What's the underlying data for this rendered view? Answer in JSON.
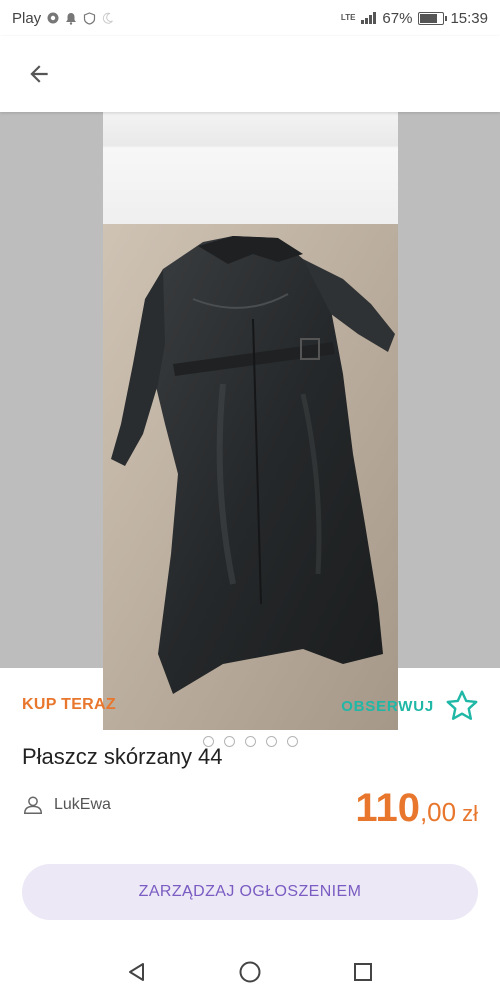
{
  "status_bar": {
    "carrier": "Play",
    "lte": "LTE",
    "battery": "67%",
    "battery_level": 0.67,
    "time": "15:39",
    "icons": [
      "chrome-icon",
      "notification-bell-icon",
      "vpn-icon",
      "moon-icon"
    ]
  },
  "app_bar": {
    "back_icon": "arrow-left-icon"
  },
  "gallery": {
    "image": "black-leather-coat-photo",
    "dot_count": 5,
    "active_dot": 0
  },
  "listing": {
    "buy_now_label": "KUP TERAZ",
    "watch_label": "OBSERWUJ",
    "watch_icon": "star-outline-icon",
    "title": "Płaszcz skórzany 44",
    "seller_icon": "user-icon",
    "seller_name": "LukEwa",
    "price_int": "110",
    "price_dec": ",00",
    "price_currency": "zł",
    "manage_button_label": "ZARZĄDZAJ OGŁOSZENIEM"
  },
  "colors": {
    "accent_orange": "#e8762c",
    "accent_teal": "#1fb7a6",
    "button_bg": "#ece8f6",
    "button_text": "#7a5cc2"
  },
  "nav_bar": {
    "icons": [
      "back-triangle-icon",
      "home-circle-icon",
      "recents-square-icon"
    ]
  }
}
